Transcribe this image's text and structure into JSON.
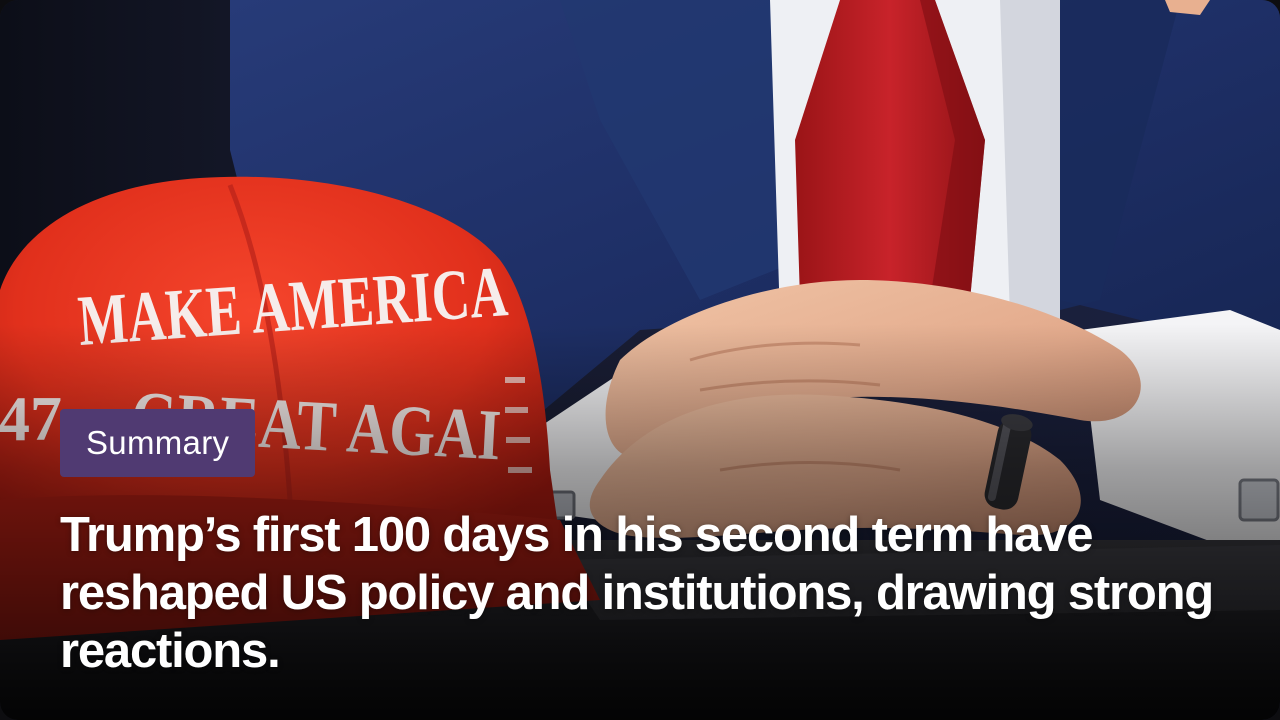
{
  "badge": {
    "label": "Summary"
  },
  "headline": {
    "text": "Trump’s first 100 days in his second term have reshaped US policy and institutions, drawing strong reactions."
  },
  "photo": {
    "hat_lines": [
      "MAKE AMERICA",
      "GREAT AGAI"
    ],
    "hat_side_number": "47"
  },
  "colors": {
    "badge_bg": "#503a72",
    "headline": "#ffffff"
  }
}
